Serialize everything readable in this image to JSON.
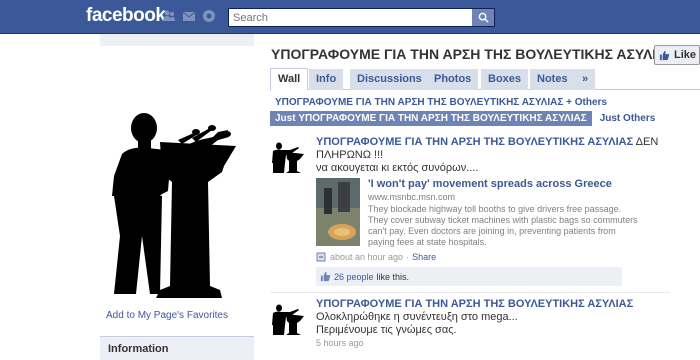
{
  "topbar": {
    "logo": "facebook",
    "search_placeholder": "Search",
    "jewels": [
      "friend-requests-icon",
      "messages-icon",
      "notifications-icon"
    ]
  },
  "colors": {
    "brand": "#3b5998",
    "link": "#3b5998",
    "tab_bg": "#d8dfea",
    "panel_bg": "#eceff5"
  },
  "left": {
    "favorites_link": "Add to My Page's Favorites",
    "info_title": "Information"
  },
  "page": {
    "title": "ΥΠΟΓΡΑΦΟΥΜΕ ΓΙΑ ΤΗΝ ΑΡΣΗ ΤΗΣ ΒΟΥΛΕΥΤΙΚΗΣ ΑΣΥΛΙΑΣ",
    "like_label": "Like"
  },
  "tabs": [
    {
      "label": "Wall",
      "active": true
    },
    {
      "label": "Info"
    },
    {
      "label": "Discussions"
    },
    {
      "label": "Photos"
    },
    {
      "label": "Boxes"
    },
    {
      "label": "Notes"
    },
    {
      "label": "»"
    }
  ],
  "filter": {
    "all_label": "ΥΠΟΓΡΑΦΟΥΜΕ ΓΙΑ ΤΗΝ ΑΡΣΗ ΤΗΣ ΒΟΥΛΕΥΤΙΚΗΣ ΑΣΥΛΙΑΣ + Others",
    "just_page_label": "Just ΥΠΟΓΡΑΦΟΥΜΕ ΓΙΑ ΤΗΝ ΑΡΣΗ ΤΗΣ ΒΟΥΛΕΥΤΙΚΗΣ ΑΣΥΛΙΑΣ",
    "just_others_label": "Just Others"
  },
  "stories": [
    {
      "actor": "ΥΠΟΓΡΑΦΟΥΜΕ ΓΙΑ ΤΗΝ ΑΡΣΗ ΤΗΣ ΒΟΥΛΕΥΤΙΚΗΣ ΑΣΥΛΙΑΣ",
      "message_1": "ΔΕΝ",
      "message_2": "ΠΛΗΡΩΝΩ !!!",
      "message_3": "να ακουγεται κι εκτός συνόρων....",
      "attachment": {
        "title": "'I won't pay' movement spreads across Greece",
        "url": "www.msnbc.msn.com",
        "description": "They blockade highway toll booths to give drivers free passage. They cover subway ticket machines with plastic bags so commuters can't pay. Even doctors are joining in, preventing patients from paying fees at state hospitals."
      },
      "time": "about an hour ago",
      "separator": "·",
      "share_label": "Share",
      "likes_count": "26 people",
      "likes_suffix": "like this."
    },
    {
      "actor": "ΥΠΟΓΡΑΦΟΥΜΕ ΓΙΑ ΤΗΝ ΑΡΣΗ ΤΗΣ ΒΟΥΛΕΥΤΙΚΗΣ ΑΣΥΛΙΑΣ",
      "message_1": "Ολοκληρώθηκε η συνέντευξη στο mega...",
      "message_2": "Περιμένουμε τις γνώμες σας.",
      "time": "5 hours ago"
    }
  ]
}
